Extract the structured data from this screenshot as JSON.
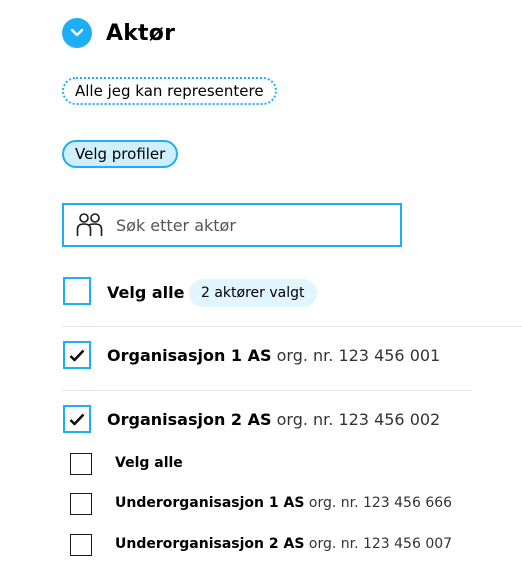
{
  "header": {
    "title": "Aktør"
  },
  "chips": {
    "all_represent": "Alle jeg kan representere",
    "choose_profiles": "Velg profiler"
  },
  "search": {
    "placeholder": "Søk etter aktør"
  },
  "select_all": {
    "label": "Velg alle",
    "badge": "2 aktører valgt",
    "checked": false
  },
  "organizations": [
    {
      "name": "Organisasjon 1 AS",
      "orgnr": "org. nr. 123 456 001",
      "checked": true
    },
    {
      "name": "Organisasjon 2 AS",
      "orgnr": "org. nr. 123 456 002",
      "checked": true
    }
  ],
  "suborg_section": {
    "select_all_label": "Velg alle",
    "items": [
      {
        "name": "Underorganisasjon 1 AS",
        "orgnr": "org. nr. 123 456 666",
        "checked": false
      },
      {
        "name": "Underorganisasjon 2 AS",
        "orgnr": "org. nr. 123 456 007",
        "checked": false
      }
    ]
  },
  "colors": {
    "accent": "#1eadf7",
    "chip_selected_bg": "#cfeffc",
    "badge_bg": "#e0f5fd"
  },
  "icons": {
    "toggle": "chevron-down-icon",
    "search": "people-icon",
    "check": "checkmark-icon"
  }
}
